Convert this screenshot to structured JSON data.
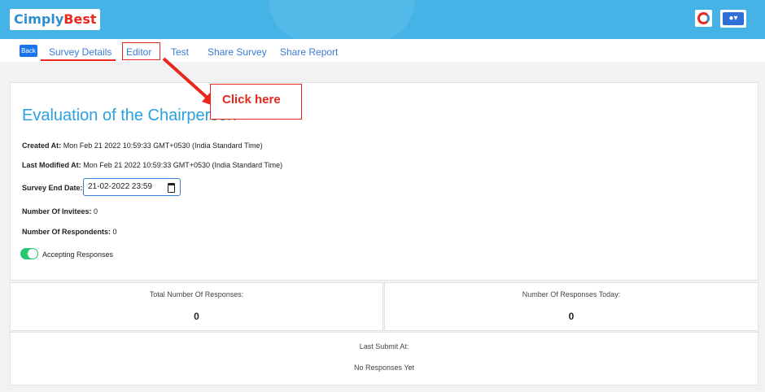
{
  "header": {
    "logo_prefix": "Cimply",
    "logo_suffix": "Best",
    "brand_color": "#45b3e6"
  },
  "tabs": {
    "back_label": "Back",
    "items": [
      "Survey Details",
      "Editor",
      "Test",
      "Share Survey",
      "Share Report"
    ],
    "active": "Survey Details"
  },
  "annotation": {
    "callout_text": "Click here",
    "color": "#e8281f"
  },
  "survey": {
    "title": "Evaluation of the Chairperson",
    "created_label": "Created At:",
    "created_value": "Mon Feb 21 2022 10:59:33 GMT+0530 (India Standard Time)",
    "modified_label": "Last Modified At:",
    "modified_value": "Mon Feb 21 2022 10:59:33 GMT+0530 (India Standard Time)",
    "end_date_label": "Survey End Date:",
    "end_date_value": "21-02-2022 23:59",
    "invitees_label": "Number Of Invitees:",
    "invitees_value": "0",
    "respondents_label": "Number Of Respondents:",
    "respondents_value": "0",
    "accepting_label": "Accepting Responses",
    "accepting_on": true
  },
  "stats": {
    "total_label": "Total Number Of Responses:",
    "total_value": "0",
    "today_label": "Number Of Responses Today:",
    "today_value": "0",
    "last_submit_label": "Last Submit At:",
    "last_submit_value": "No Responses Yet"
  },
  "icons": [
    "ring-icon",
    "user-icon",
    "calendar-icon"
  ]
}
